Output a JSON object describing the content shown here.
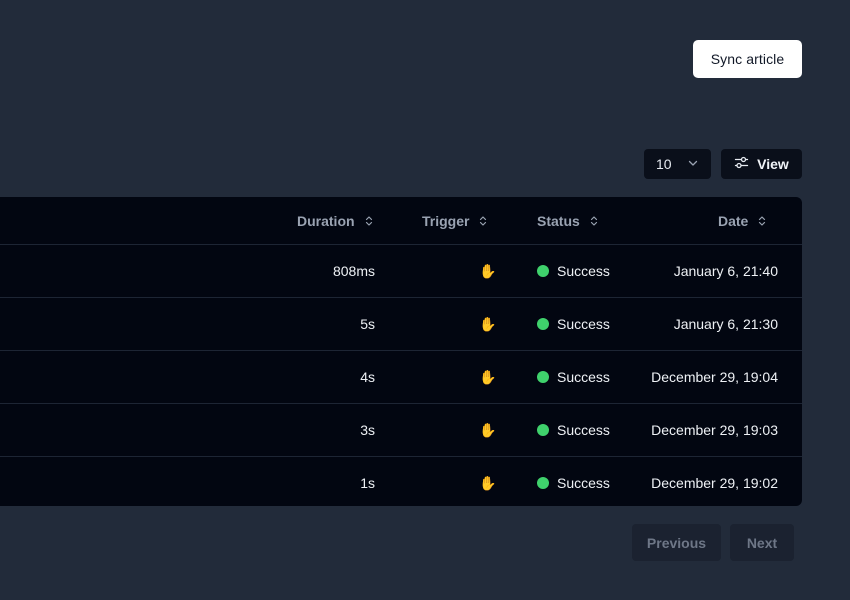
{
  "header": {
    "sync_label": "Sync article"
  },
  "toolbar": {
    "per_page_value": "10",
    "view_label": "View",
    "chevron_icon": "chevron-down-icon",
    "view_icon": "sliders-icon"
  },
  "table": {
    "columns": {
      "duration": "Duration",
      "trigger": "Trigger",
      "status": "Status",
      "date": "Date"
    },
    "rows": [
      {
        "duration": "808ms",
        "trigger": "✋",
        "status": "Success",
        "date": "January 6, 21:40"
      },
      {
        "duration": "5s",
        "trigger": "✋",
        "status": "Success",
        "date": "January 6, 21:30"
      },
      {
        "duration": "4s",
        "trigger": "✋",
        "status": "Success",
        "date": "December 29, 19:04"
      },
      {
        "duration": "3s",
        "trigger": "✋",
        "status": "Success",
        "date": "December 29, 19:03"
      },
      {
        "duration": "1s",
        "trigger": "✋",
        "status": "Success",
        "date": "December 29, 19:02"
      }
    ],
    "status_color": "#3fd16c"
  },
  "pagination": {
    "previous_label": "Previous",
    "next_label": "Next"
  }
}
